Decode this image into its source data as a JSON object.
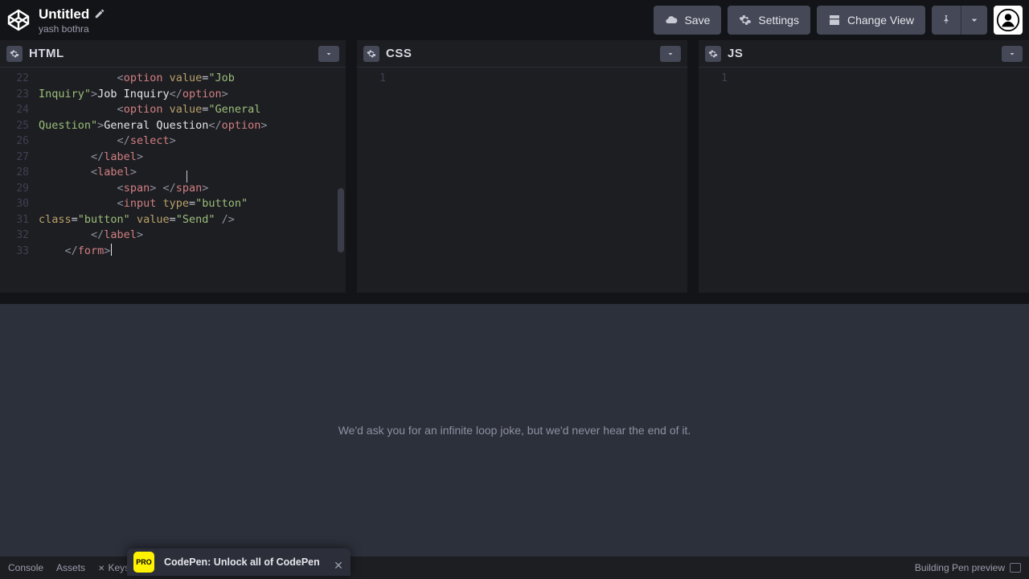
{
  "header": {
    "title": "Untitled",
    "author": "yash bothra",
    "buttons": {
      "save": "Save",
      "settings": "Settings",
      "change_view": "Change View"
    }
  },
  "panes": {
    "html": {
      "label": "HTML"
    },
    "css": {
      "label": "CSS"
    },
    "js": {
      "label": "JS"
    }
  },
  "code": {
    "gutter_start": 22,
    "option1_text": "Job Inquiry",
    "option1_val": "Job Inquiry",
    "option2_text": "General Question",
    "option2_val": "General Question",
    "input_type": "button",
    "input_class": "button",
    "input_value": "Send"
  },
  "preview": {
    "message": "We'd ask you for an infinite loop joke, but we'd never hear the end of it."
  },
  "footer": {
    "console": "Console",
    "assets": "Assets",
    "keys": "Keys",
    "status": "Building Pen preview"
  },
  "promo": {
    "badge": "PRO",
    "text": "CodePen: Unlock all of CodePen"
  }
}
